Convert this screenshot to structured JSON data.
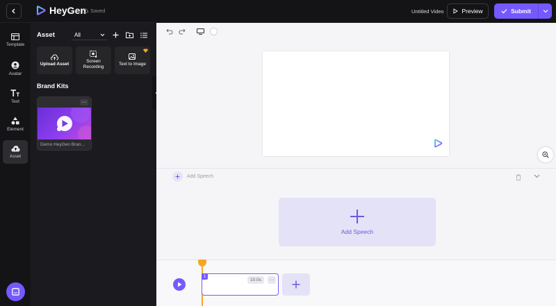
{
  "app": {
    "name": "HeyGen",
    "save_status": "Saved"
  },
  "header": {
    "video_title": "Untitled Video",
    "preview_label": "Preview",
    "submit_label": "Submit"
  },
  "nav": {
    "items": [
      {
        "label": "Template",
        "icon": "template-icon"
      },
      {
        "label": "Avatar",
        "icon": "avatar-icon"
      },
      {
        "label": "Text",
        "icon": "text-icon"
      },
      {
        "label": "Element",
        "icon": "element-icon"
      },
      {
        "label": "Asset",
        "icon": "asset-icon",
        "active": true
      }
    ]
  },
  "asset_panel": {
    "title": "Asset",
    "filter_value": "All",
    "cards": [
      {
        "label": "Upload Asset",
        "icon": "upload-icon"
      },
      {
        "label": "Screen Recording",
        "icon": "screen-record-icon"
      },
      {
        "label": "Text to Image",
        "icon": "image-icon",
        "premium": true
      }
    ],
    "brand_kits_title": "Brand Kits",
    "brand_kit": {
      "name": "Demo HeyGen Bran...",
      "more": "···"
    }
  },
  "speech": {
    "add_speech_small": "Add Speech",
    "add_speech_card": "Add Speech"
  },
  "timeline": {
    "clip_index": "1",
    "clip_duration": "10.0s",
    "clip_more": "···"
  },
  "colors": {
    "accent": "#7559ff",
    "playhead": "#f5a623",
    "dark_bg": "#141417",
    "panel_bg": "#1b1b1f",
    "canvas_bg": "#f5f5f7"
  }
}
